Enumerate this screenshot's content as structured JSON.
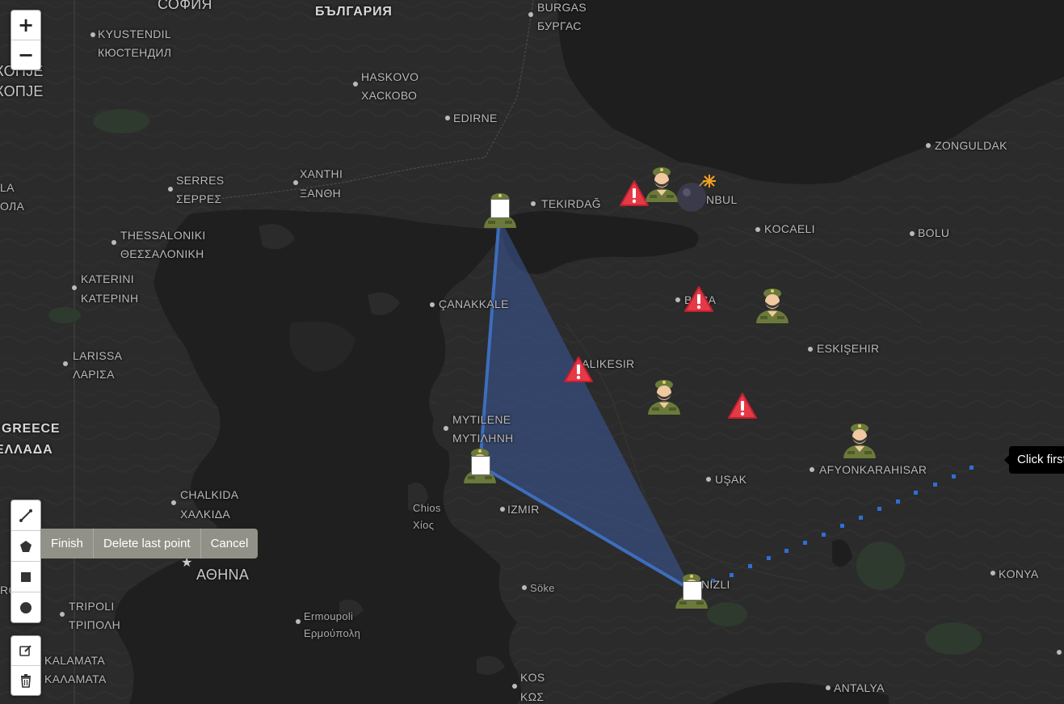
{
  "map": {
    "labels": {
      "sofia": "СОФИЯ",
      "bulgaria": "БЪЛГАРИЯ",
      "burgas": "BURGAS",
      "burgas_local": "БУРГАС",
      "kyustendil": "KYUSTENDIL",
      "kyustendil_local": "КЮСТЕНДИЛ",
      "skopje_top": "КОПЈЕ",
      "skopje": "КОПЈЕ",
      "haskovo": "HASKOVO",
      "haskovo_local": "ХАСКОВО",
      "edirne": "EDIRNE",
      "zonguldak": "ZONGULDAK",
      "serres": "SERRES",
      "serres_local": "ΣΕΡΡΕΣ",
      "xanthi": "XANTHI",
      "xanthi_local": "ΞΑΝΘΗ",
      "tekirdag": "TEKIRDAĞ",
      "istanbul": "NBUL",
      "kocaeli": "KOCAELI",
      "bolu": "BOLU",
      "la": "LA",
      "ola": "ОЛА",
      "thessaloniki": "THESSALONIKI",
      "thessaloniki_local": "ΘΕΣΣΑΛΟΝΙΚΗ",
      "katerini": "KATERINI",
      "katerini_local": "ΚΑΤΕΡΙΝΗ",
      "canakkale": "ÇANAKKALE",
      "bursa": "BRSA",
      "eskisehir": "ESKIŞEHIR",
      "larissa": "LARISSA",
      "larissa_local": "ΛΑΡΙΣΑ",
      "balikesir": "ALIKESIR",
      "greece": "GREECE",
      "greece_local": "ΕΛΛΑΔΑ",
      "mytilene": "MYTILENE",
      "mytilene_local": "ΜΥΤΙΛΗΝΗ",
      "usak": "UŞAK",
      "afyon": "AFYONKARAHISAR",
      "chalkida": "CHALKIDA",
      "chalkida_local": "ΧΑΛΚΙΔΑ",
      "chios": "Chios",
      "chios_local": "Χίος",
      "izmir": "IZMIR",
      "athens": "ΑΘΗΝΑ",
      "soke": "Söke",
      "denizli": "NIZLI",
      "konya": "KONYA",
      "tripoli": "TRIPOLI",
      "tripoli_local": "ΤΡΙΠΟΛΗ",
      "ermoupoli": "Ermoupoli",
      "ermoupoli_local": "Ερμούπολη",
      "kalamata": "KALAMATA",
      "kalamata_local": "ΚΑΛΑΜΑΤΑ",
      "kos": "KOS",
      "kos_local": "ΚΩΣ",
      "antalya": "ANTALYA",
      "rg": "RG"
    },
    "colors": {
      "land": "#2b2b2b",
      "water": "#1f1f1f",
      "polygon_fill": "#3a5a9a",
      "polygon_stroke": "#3f73c9",
      "warning": "#e63946",
      "soldier": "#6b7a3a",
      "guide_dots": "#2f6ed6"
    }
  },
  "controls": {
    "zoom_in": "+",
    "zoom_out": "−",
    "draw_tools": [
      "draw-polyline",
      "draw-polygon",
      "draw-rectangle",
      "draw-circle"
    ],
    "edit_tools": [
      "edit-layers",
      "delete-layers"
    ]
  },
  "draw_actions": {
    "finish": "Finish",
    "delete_last": "Delete last point",
    "cancel": "Cancel"
  },
  "tooltip": {
    "text": "Click first"
  },
  "markers": {
    "soldier_icon": "soldier-icon",
    "warning_icon": "warning-icon",
    "bomb_icon": "bomb-icon"
  }
}
